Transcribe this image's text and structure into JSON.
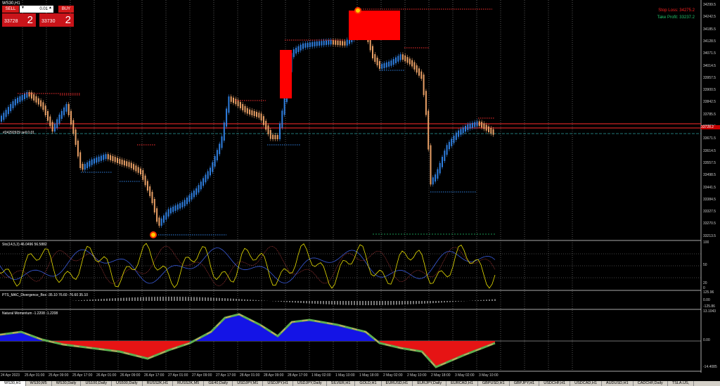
{
  "window": {
    "title": "WS30,H1"
  },
  "trade_panel": {
    "sell_label": "SELL",
    "buy_label": "BUY",
    "lot_value": "0.01",
    "sell_price_main": "33728",
    "sell_price_big": "2",
    "buy_price_main": "33730",
    "buy_price_big": "2",
    "up_arrow": "▲",
    "down_arrow": "▼"
  },
  "levels": {
    "stop_loss": "Stop Loss: 34275.2",
    "take_profit": "Take Profit: 33237.2",
    "order_line": "#24292929 sell 0.01",
    "current_price_tag": "33728.2"
  },
  "price_axis": [
    "34299.5",
    "34242.5",
    "34185.5",
    "34128.5",
    "34071.5",
    "34014.5",
    "33957.5",
    "33900.5",
    "33842.5",
    "33785.5",
    "33728.5",
    "33671.5",
    "33614.5",
    "33557.5",
    "33498.5",
    "33441.5",
    "33384.5",
    "33327.5",
    "33270.5",
    "33213.5"
  ],
  "indicators": {
    "stoch": {
      "label": "Sto(14,5,3) 46.0496 56.5882",
      "axis": [
        "100",
        "50",
        "20",
        "0"
      ]
    },
    "macd": {
      "label": "PTS_MAC_Divergence_Box -35.10 76.60 -76.60 35.10",
      "axis": [
        "125.96",
        "0.00",
        "-125.86"
      ]
    },
    "momentum": {
      "label": "Natural Momentum -1.2208 -1.2208",
      "axis": [
        "13.1043",
        "0.00",
        "-14.4085"
      ]
    }
  },
  "time_axis": [
    "24 Apr 2023",
    "25 Apr 01:00",
    "25 Apr 09:00",
    "25 Apr 17:00",
    "26 Apr 01:00",
    "26 Apr 09:00",
    "26 Apr 17:00",
    "27 Apr 01:00",
    "27 Apr 09:00",
    "27 Apr 17:00",
    "28 Apr 01:00",
    "28 Apr 09:00",
    "28 Apr 17:00",
    "1 May 02:00",
    "1 May 10:00",
    "1 May 18:00",
    "2 May 02:00",
    "2 May 10:00",
    "2 May 18:00",
    "3 May 02:00",
    "3 May 10:00"
  ],
  "tabs": [
    "WS30,H1",
    "WS30,M5",
    "WS30,Daily",
    "US100,Daily",
    "US500,Daily",
    "RUSS2K,H1",
    "RUSS2K,M5",
    "GE40,Daily",
    "USDJPY,M1",
    "USDJPY,H1",
    "USDJPY,Daily",
    "SILVER,H1",
    "GOLD,H1",
    "EURUSD,H1",
    "EURJPY,Daily",
    "EURCAD,H1",
    "GBPUSD,H1",
    "GBPJPY,H1",
    "USDCHF,H1",
    "USDCAD,H1",
    "AUDUSD,H1",
    "CADCHF,Daily",
    "TSLA.US,"
  ],
  "colors": {
    "bull": "#2f7fe0",
    "bear": "#e9a066",
    "stop": "#ff0000",
    "tp": "#22c36b"
  }
}
